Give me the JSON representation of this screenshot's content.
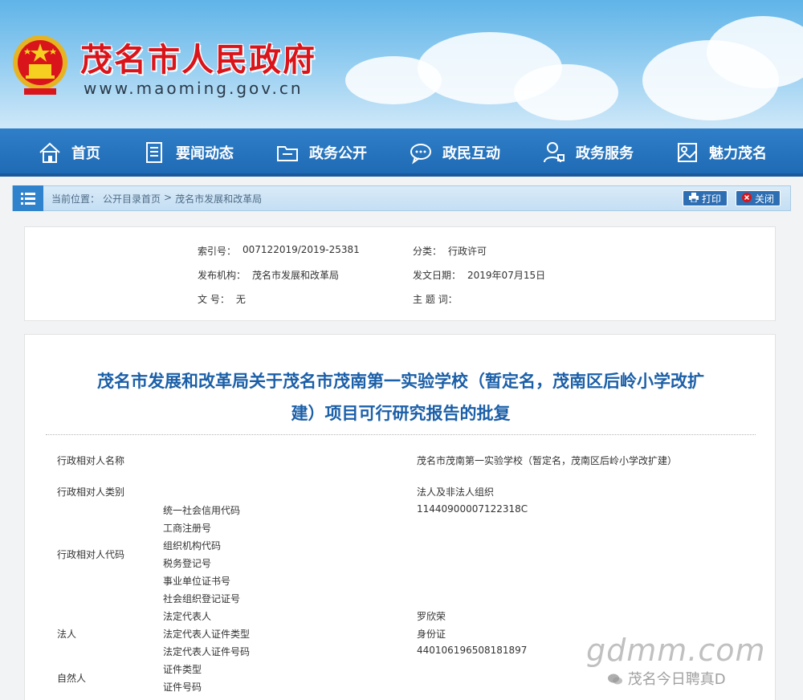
{
  "header": {
    "site_title": "茂名市人民政府",
    "site_url": "www.maoming.gov.cn"
  },
  "nav": {
    "items": [
      {
        "label": "首页",
        "icon": "home-icon"
      },
      {
        "label": "要闻动态",
        "icon": "document-icon"
      },
      {
        "label": "政务公开",
        "icon": "folder-icon"
      },
      {
        "label": "政民互动",
        "icon": "chat-icon"
      },
      {
        "label": "政务服务",
        "icon": "user-service-icon"
      },
      {
        "label": "魅力茂名",
        "icon": "picture-icon"
      }
    ]
  },
  "breadcrumb": {
    "prefix": "当前位置：",
    "item1": "公开目录首页",
    "sep": ">",
    "item2": "茂名市发展和改革局",
    "print_label": "打印",
    "close_label": "关闭"
  },
  "meta": {
    "index_label": "索引号：",
    "index_value": "007122019/2019-25381",
    "category_label": "分类：",
    "category_value": "行政许可",
    "publisher_label": "发布机构：",
    "publisher_value": "茂名市发展和改革局",
    "date_label": "发文日期：",
    "date_value": "2019年07月15日",
    "docno_label": "文 号：",
    "docno_value": "无",
    "keywords_label": "主 题 词：",
    "keywords_value": ""
  },
  "article": {
    "title_line1": "茂名市发展和改革局关于茂名市茂南第一实验学校（暂定名，茂南区后岭小学改扩",
    "title_line2": "建）项目可行研究报告的批复",
    "rows": {
      "party_name_label": "行政相对人名称",
      "party_name_value": "茂名市茂南第一实验学校（暂定名，茂南区后岭小学改扩建）",
      "party_type_label": "行政相对人类别",
      "party_type_value": "法人及非法人组织",
      "party_code_label": "行政相对人代码",
      "code_sub_labels": [
        "统一社会信用代码",
        "工商注册号",
        "组织机构代码",
        "税务登记号",
        "事业单位证书号",
        "社会组织登记证号"
      ],
      "credit_code_value": "11440900007122318C",
      "legal_label": "法人",
      "legal_sub_labels": [
        "法定代表人",
        "法定代表人证件类型",
        "法定代表人证件号码"
      ],
      "legal_rep_value": "罗欣荣",
      "legal_id_type_value": "身份证",
      "legal_id_no_value": "440106196508181897",
      "natural_label": "自然人",
      "natural_sub_labels": [
        "证件类型",
        "证件号码"
      ]
    }
  },
  "watermark": {
    "big": "gdmm.com",
    "small": "茂名今日聘真D"
  },
  "colors": {
    "title_red": "#d9151b",
    "nav_blue": "#1e69b3",
    "article_title_blue": "#1b5fa8"
  }
}
